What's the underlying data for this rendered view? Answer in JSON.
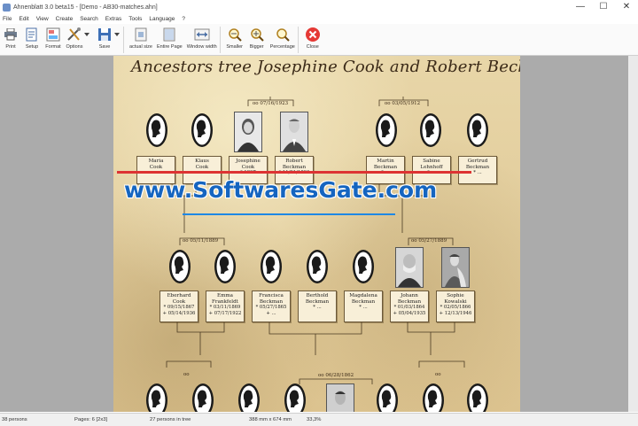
{
  "window": {
    "title": "Ahnenblatt 3.0 beta15 - [Demo - AB30-matches.ahn]",
    "minimize": "—",
    "maximize": "☐",
    "close": "✕"
  },
  "menu": [
    "File",
    "Edit",
    "View",
    "Create",
    "Search",
    "Extras",
    "Tools",
    "Language",
    "?"
  ],
  "toolbar": {
    "print": "Print",
    "setup": "Setup",
    "format": "Format",
    "options": "Options",
    "save": "Save",
    "actual_size": "actual size",
    "entire_page": "Entire Page",
    "window_width": "Window width",
    "smaller": "Smaller",
    "bigger": "Bigger",
    "percentage": "Percentage",
    "close": "Close"
  },
  "tree": {
    "title": "Ancestors tree Josephine Cook and Robert Beckman",
    "marriages": {
      "top_left": "oo 07/16/1923",
      "top_right": "oo 03/05/1912",
      "mid_left": "oo 05/11/1889",
      "mid_right": "oo 05/27/1889",
      "bottom_left": "oo",
      "bottom_center": "oo 06/28/1862",
      "bottom_right": "oo"
    },
    "row1": [
      {
        "name": "Maria",
        "name2": "Cook",
        "dates": "",
        "kind": "silhouette"
      },
      {
        "name": "Klaus",
        "name2": "Cook",
        "dates": "",
        "kind": "silhouette"
      },
      {
        "name": "Josephine",
        "name2": "Cook",
        "dates": "* 1897",
        "kind": "photo"
      },
      {
        "name": "Robert",
        "name2": "Beckman",
        "dates": "* 11/21/1890",
        "kind": "photo"
      },
      {
        "name": "Martin",
        "name2": "Beckman",
        "dates": "* ...",
        "kind": "silhouette"
      },
      {
        "name": "Sabine",
        "name2": "Lehnhoff",
        "dates": "* ...",
        "kind": "silhouette"
      },
      {
        "name": "Gertrud",
        "name2": "Beckman",
        "dates": "* ...",
        "kind": "silhouette"
      }
    ],
    "row2": [
      {
        "name": "Eberhard",
        "name2": "Cook",
        "d1": "* 09/15/1867",
        "d2": "+ 05/14/1936",
        "kind": "silhouette"
      },
      {
        "name": "Emma",
        "name2": "Frankfeldt",
        "d1": "* 03/11/1869",
        "d2": "+ 07/17/1922",
        "kind": "silhouette"
      },
      {
        "name": "Francisca",
        "name2": "Beckman",
        "d1": "* 05/27/1865",
        "d2": "+ ...",
        "kind": "silhouette"
      },
      {
        "name": "Berthold",
        "name2": "Beckman",
        "d1": "* ...",
        "d2": "",
        "kind": "silhouette"
      },
      {
        "name": "Magdalena",
        "name2": "Beckman",
        "d1": "* ...",
        "d2": "",
        "kind": "silhouette"
      },
      {
        "name": "Johann",
        "name2": "Beckman",
        "d1": "* 01/03/1864",
        "d2": "+ 05/04/1935",
        "kind": "photo"
      },
      {
        "name": "Sophie",
        "name2": "Kowalski",
        "d1": "* 02/05/1866",
        "d2": "+ 12/13/1946",
        "kind": "photo"
      }
    ]
  },
  "watermark": "www.SoftwaresGate.com",
  "status": {
    "persons": "38 persons",
    "pages": "Pages: 6 [2x3]",
    "persons_in_tree": "27 persons in tree",
    "size": "388 mm x 674 mm",
    "zoom": "33,3%"
  }
}
